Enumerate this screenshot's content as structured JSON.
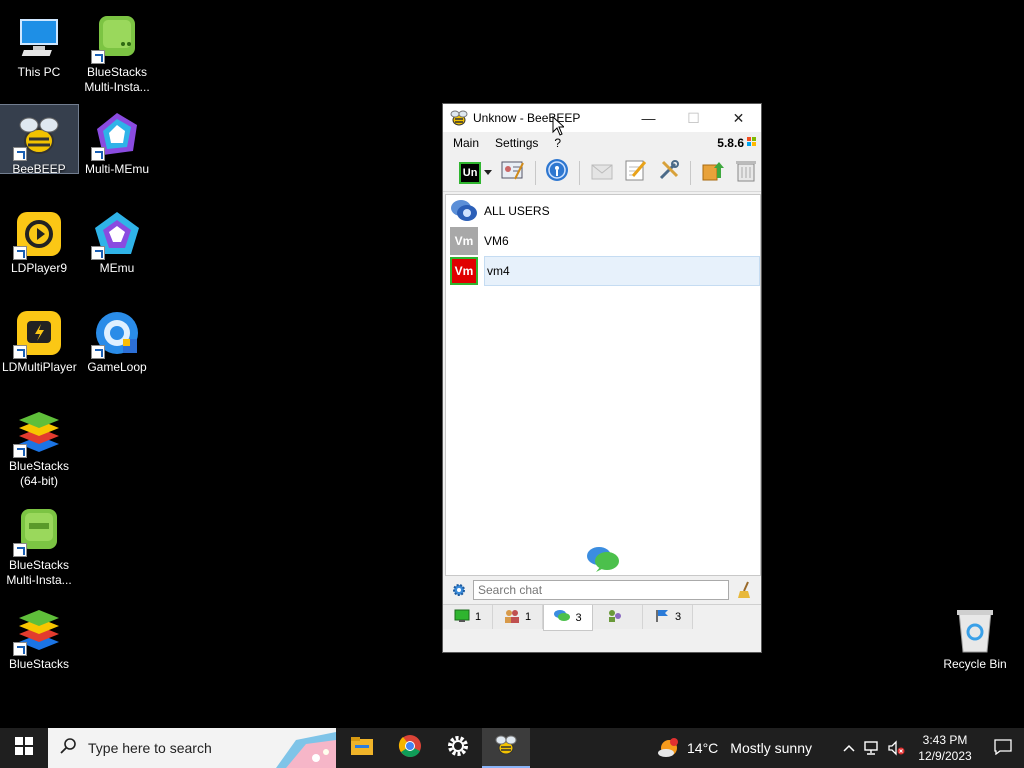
{
  "desktop": {
    "icons": [
      {
        "label": "This PC"
      },
      {
        "label": "BlueStacks Multi-Insta..."
      },
      {
        "label": "BeeBEEP"
      },
      {
        "label": "Multi-MEmu"
      },
      {
        "label": "LDPlayer9"
      },
      {
        "label": "MEmu"
      },
      {
        "label": "LDMultiPlayer"
      },
      {
        "label": "GameLoop"
      },
      {
        "label": "BlueStacks (64-bit)"
      },
      {
        "label": "BlueStacks Multi-Insta..."
      },
      {
        "label": "BlueStacks"
      },
      {
        "label": "Recycle Bin"
      }
    ]
  },
  "window": {
    "title": "Unknow - BeeBEEP",
    "menu": {
      "main": "Main",
      "settings": "Settings",
      "help": "?"
    },
    "version": "5.8.6",
    "status_badge": "Un",
    "users": [
      {
        "name": "ALL USERS",
        "avatar": ""
      },
      {
        "name": "VM6",
        "avatar": "Vm",
        "color": "#a8a8a8"
      },
      {
        "name": "vm4",
        "avatar": "Vm",
        "color": "#e00000"
      }
    ],
    "search_placeholder": "Search chat",
    "tabs": [
      {
        "count": "1"
      },
      {
        "count": "1"
      },
      {
        "count": "3"
      },
      {
        "count": ""
      },
      {
        "count": "3"
      }
    ]
  },
  "taskbar": {
    "search_placeholder": "Type here to search",
    "weather_temp": "14°C",
    "weather_desc": "Mostly sunny",
    "time": "3:43 PM",
    "date": "12/9/2023"
  },
  "colors": {
    "accent": "#0078d7",
    "taskbar": "#1f1f1f",
    "online": "#2fb52f"
  }
}
